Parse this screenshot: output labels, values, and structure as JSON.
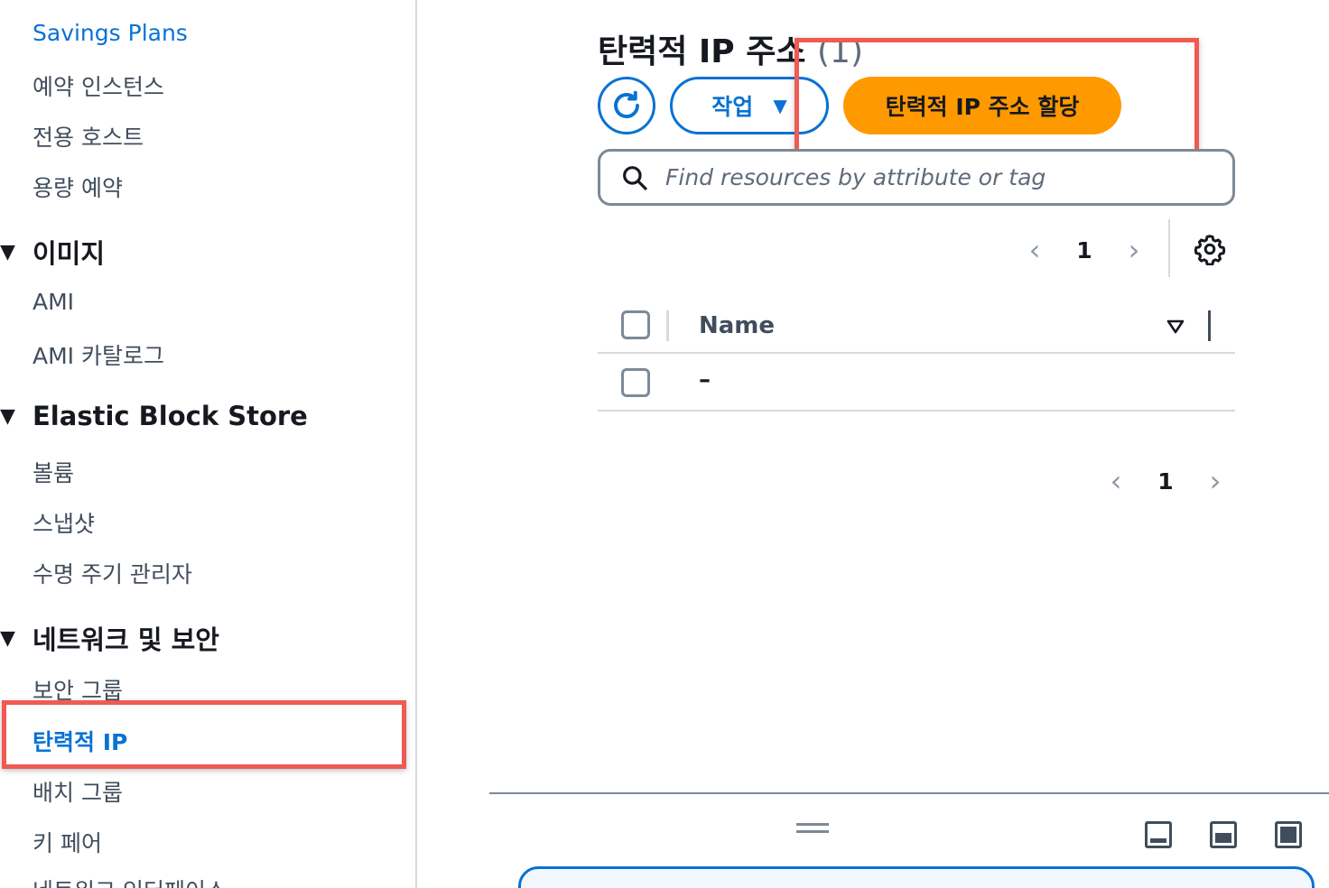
{
  "sidebar": {
    "items_top": [
      {
        "label": "Savings Plans"
      },
      {
        "label": "예약 인스턴스"
      },
      {
        "label": "전용 호스트"
      },
      {
        "label": "용량 예약"
      }
    ],
    "sections": [
      {
        "title": "이미지",
        "items": [
          {
            "label": "AMI"
          },
          {
            "label": "AMI 카탈로그"
          }
        ]
      },
      {
        "title": "Elastic Block Store",
        "items": [
          {
            "label": "볼륨"
          },
          {
            "label": "스냅샷"
          },
          {
            "label": "수명 주기 관리자"
          }
        ]
      },
      {
        "title": "네트워크 및 보안",
        "items": [
          {
            "label": "보안 그룹"
          },
          {
            "label": "탄력적 IP"
          },
          {
            "label": "배치 그룹"
          },
          {
            "label": "키 페어"
          },
          {
            "label": "네트워크 인터페이스"
          }
        ]
      }
    ]
  },
  "main": {
    "title": "탄력적 IP 주소",
    "count": "(1)",
    "actions_label": "작업",
    "allocate_label": "탄력적 IP 주소 할당",
    "search_placeholder": "Find resources by attribute or tag",
    "pagination_top": {
      "page": "1"
    },
    "pagination_bottom": {
      "page": "1"
    },
    "table": {
      "columns": [
        "Name"
      ],
      "rows": [
        {
          "name": "–"
        }
      ]
    }
  },
  "icons": {
    "refresh": "refresh-icon",
    "search": "search-icon",
    "settings": "gear-icon",
    "sort": "sort-down-icon"
  },
  "colors": {
    "accent": "#0972d3",
    "primary_button": "#ff9900",
    "highlight_box": "#ef5a52"
  }
}
